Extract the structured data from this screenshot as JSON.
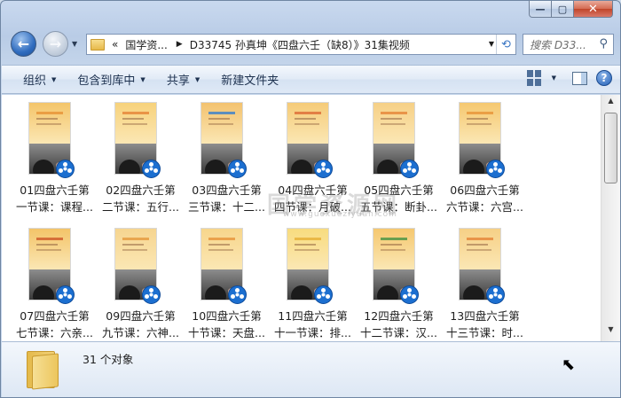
{
  "window": {
    "caption_min": "—",
    "caption_max": "▢",
    "caption_close": "✕"
  },
  "nav": {
    "back_glyph": "←",
    "forward_glyph": "→",
    "dropdown_glyph": "▼"
  },
  "address": {
    "overflow": "«",
    "crumbs": [
      "国学资...",
      "D33745 孙真坤《四盘六壬（缺8）》31集视频"
    ],
    "separator": "▶",
    "dropdown_glyph": "▼",
    "refresh_glyph": "⟲"
  },
  "search": {
    "placeholder": "搜索 D33...",
    "icon": "search-icon"
  },
  "toolbar": {
    "organize": "组织",
    "include_in_library": "包含到库中",
    "share": "共享",
    "new_folder": "新建文件夹",
    "arrow": "▼",
    "help": "?"
  },
  "files": [
    {
      "line1": "01四盘六壬第",
      "line2": "一节课：课程...",
      "screen": "#f4c56a",
      "accent": "#e58a2c"
    },
    {
      "line1": "02四盘六壬第",
      "line2": "二节课：五行...",
      "screen": "#f7d27c",
      "accent": "#e2772b"
    },
    {
      "line1": "03四盘六壬第",
      "line2": "三节课：十二...",
      "screen": "#f3c26f",
      "accent": "#1c74d8"
    },
    {
      "line1": "04四盘六壬第",
      "line2": "四节课：月破...",
      "screen": "#f5cb78",
      "accent": "#d85b2a"
    },
    {
      "line1": "05四盘六壬第",
      "line2": "五节课：断卦...",
      "screen": "#f6d086",
      "accent": "#e2772b"
    },
    {
      "line1": "06四盘六壬第",
      "line2": "六节课：六宫...",
      "screen": "#f5c870",
      "accent": "#e58a2c"
    },
    {
      "line1": "07四盘六壬第",
      "line2": "七节课：六亲...",
      "screen": "#f3c469",
      "accent": "#c9471c"
    },
    {
      "line1": "09四盘六壬第",
      "line2": "九节课：六神...",
      "screen": "#f6d590",
      "accent": "#e2902f"
    },
    {
      "line1": "10四盘六壬第",
      "line2": "十节课：天盘...",
      "screen": "#f7d68c",
      "accent": "#e58a2c"
    },
    {
      "line1": "11四盘六壬第",
      "line2": "十一节课：排...",
      "screen": "#f8dc7f",
      "accent": "#e4a82a"
    },
    {
      "line1": "12四盘六壬第",
      "line2": "十二节课：汉...",
      "screen": "#f5c870",
      "accent": "#2c8a3b"
    },
    {
      "line1": "13四盘六壬第",
      "line2": "十三节课：时...",
      "screen": "#f6d086",
      "accent": "#e2772b"
    }
  ],
  "watermark": {
    "text": "国学资源网",
    "url": "www.guoxueziyuan.com"
  },
  "status": {
    "count_text": "31 个对象"
  },
  "colors": {
    "accent": "#1c6fd0",
    "window_frame": "#b9cce6",
    "close": "#c0452a"
  }
}
